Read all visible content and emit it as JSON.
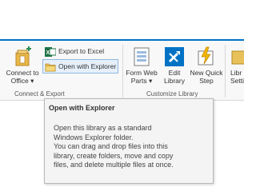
{
  "ribbon": {
    "connect_export": {
      "group_label": "Connect & Export",
      "connect_to_office": {
        "line1": "Connect to",
        "line2": "Office"
      },
      "export_to_excel": "Export to Excel",
      "open_with_explorer": "Open with Explorer"
    },
    "customize_library": {
      "group_label": "Customize Library",
      "form_web_parts": {
        "line1": "Form Web",
        "line2": "Parts"
      },
      "edit_library": {
        "line1": "Edit",
        "line2": "Library"
      },
      "new_quick_step": {
        "line1": "New Quick",
        "line2": "Step"
      }
    },
    "library_settings": {
      "line1": "Libr",
      "line2": "Setti"
    }
  },
  "tooltip": {
    "title": "Open with Explorer",
    "lines": [
      "Open this library as a standard",
      "Windows Explorer folder.",
      "You can drag and drop files into this",
      "library, create folders, move and copy",
      "files, and delete multiple files at once."
    ]
  },
  "colors": {
    "accent": "#0072c6",
    "excel_green": "#1e7145",
    "tooltip_bg": "#f4f4f4"
  }
}
